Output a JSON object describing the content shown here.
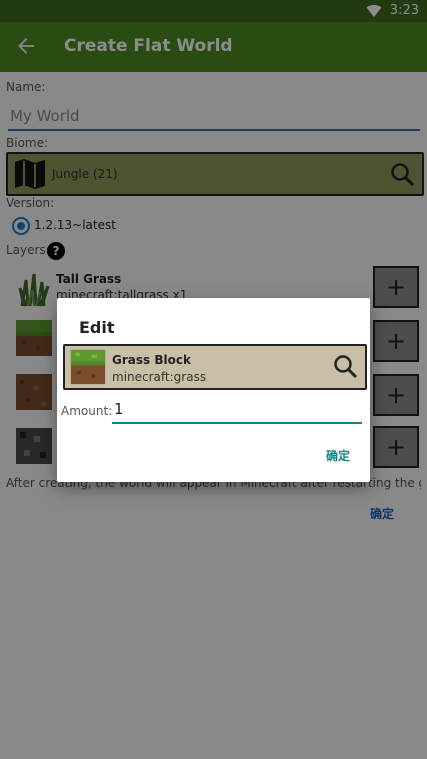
{
  "status_bar": {
    "time": "3:23"
  },
  "app_bar": {
    "title": "Create Flat World"
  },
  "form": {
    "name_label": "Name:",
    "name_value": "My World",
    "biome_label": "Biome:",
    "biome_value": "Jungle (21)",
    "version_label": "Version:",
    "version_value": "1.2.13~latest",
    "layers_label": "Layers:",
    "help_glyph": "?",
    "layers": [
      {
        "title": "Tall Grass",
        "id": "minecraft:tallgrass x1"
      },
      {
        "title": "",
        "id": ""
      },
      {
        "title": "",
        "id": ""
      },
      {
        "title": "",
        "id": ""
      }
    ],
    "add_glyph": "+",
    "after_text": "After creating, the world will appear in Minecraft after restarting the game.",
    "confirm_label": "确定"
  },
  "dialog": {
    "title": "Edit",
    "block_title": "Grass Block",
    "block_id": "minecraft:grass",
    "amount_label": "Amount:",
    "amount_value": "1",
    "ok_label": "确定"
  }
}
